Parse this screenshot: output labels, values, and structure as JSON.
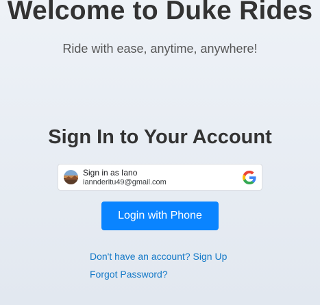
{
  "header": {
    "title": "Welcome to Duke Rides",
    "subtitle": "Ride with ease, anytime, anywhere!"
  },
  "signin": {
    "heading": "Sign In to Your Account",
    "google_account": {
      "name_label": "Sign in as Iano",
      "email": "iannderitu49@gmail.com",
      "icon": "google-g-icon"
    },
    "phone_button_label": "Login with Phone",
    "signup_link": "Don't have an account? Sign Up",
    "forgot_link": "Forgot Password?"
  },
  "colors": {
    "primary_button": "#0a84ff",
    "link": "#1479c7",
    "heading": "#333333"
  }
}
